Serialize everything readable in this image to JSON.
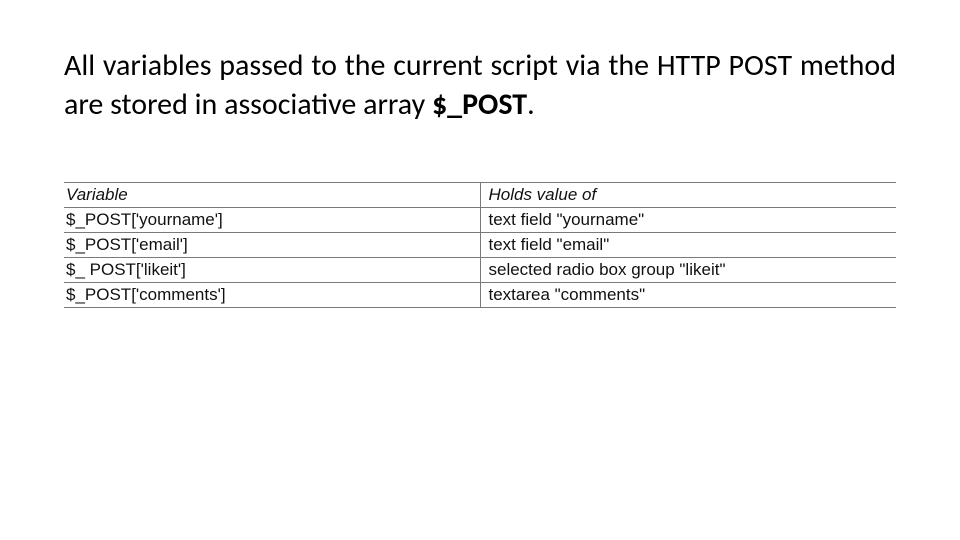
{
  "intro": {
    "prefix": "All variables passed to the current script via the HTTP POST method are stored in associative array ",
    "bold": "$_POST",
    "suffix": "."
  },
  "table": {
    "headers": {
      "col1": "Variable",
      "col2": "Holds value of"
    },
    "rows": [
      {
        "variable": "$_POST['yourname']",
        "holds": "text field \"yourname\""
      },
      {
        "variable": "$_POST['email']",
        "holds": "text field \"email\""
      },
      {
        "variable": "$_ POST['likeit']",
        "holds": "selected radio box group \"likeit\""
      },
      {
        "variable": "$_POST['comments']",
        "holds": "textarea \"comments\""
      }
    ]
  }
}
